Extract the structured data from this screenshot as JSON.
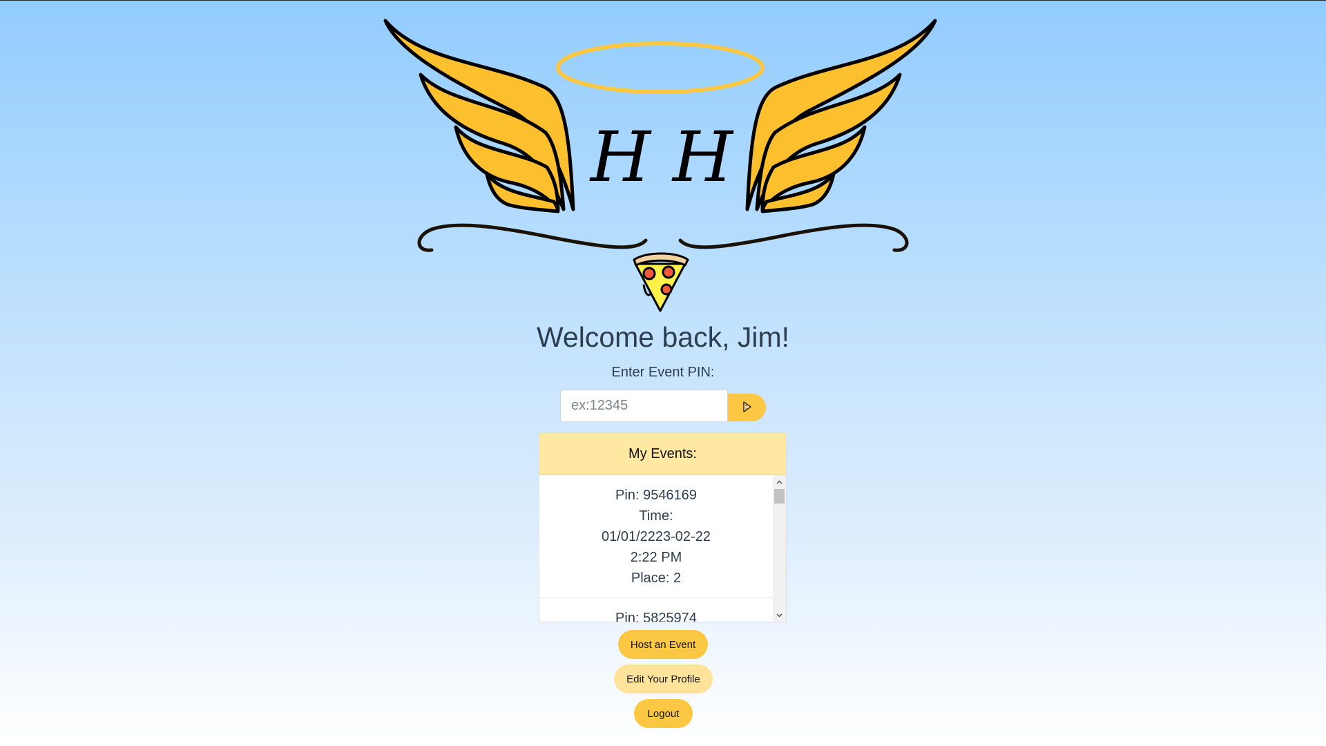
{
  "logo": {
    "monogram": "H H",
    "icon": "angel-wings-halo-pizza-logo"
  },
  "welcome": {
    "heading": "Welcome back, Jim!"
  },
  "pin_form": {
    "label": "Enter Event PIN:",
    "input_value": "",
    "placeholder": "ex:12345",
    "submit_icon": "pizza-slice-arrow-icon"
  },
  "events": {
    "title": "My Events:",
    "items": [
      {
        "pin": "Pin: 9546169",
        "time_label": "Time:",
        "date": "01/01/2223-02-22",
        "clock": "2:22 PM",
        "place": "Place: 2"
      },
      {
        "pin": "Pin: 5825974"
      }
    ]
  },
  "buttons": {
    "host": "Host an Event",
    "edit_profile": "Edit Your Profile",
    "logout": "Logout"
  },
  "colors": {
    "accent": "#fcc844",
    "accent_light": "#ffe39a",
    "header_bg": "#ffe8a1",
    "text": "#2c3e50",
    "bg_top": "#92ccff",
    "bg_bottom": "#ffffff"
  }
}
